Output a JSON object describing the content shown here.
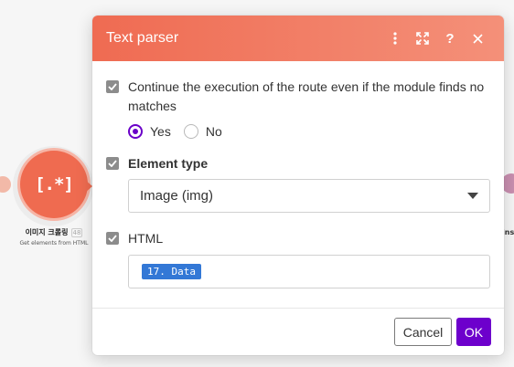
{
  "dialog": {
    "title": "Text parser",
    "header_icons": [
      "more-vertical-icon",
      "expand-icon",
      "help-icon",
      "close-icon"
    ],
    "help_glyph": "?",
    "continue_label": "Continue the execution of the route even if the module finds no matches",
    "radio": {
      "yes_label": "Yes",
      "no_label": "No",
      "selected": "Yes"
    },
    "element_type": {
      "label": "Element type",
      "selected": "Image (img)"
    },
    "html": {
      "label": "HTML",
      "pill": "17. Data"
    },
    "footer": {
      "cancel_label": "Cancel",
      "ok_label": "OK"
    }
  },
  "module": {
    "glyph": "[.*]",
    "name": "이미지 크롤링",
    "badge": "48",
    "description": "Get elements from HTML"
  },
  "right_edge_label": "ins",
  "colors": {
    "header_start": "#ef6b52",
    "header_end": "#f49079",
    "accent_purple": "#6d00cc",
    "pill_blue": "#3378d6",
    "module_orange": "#ef6b50"
  }
}
